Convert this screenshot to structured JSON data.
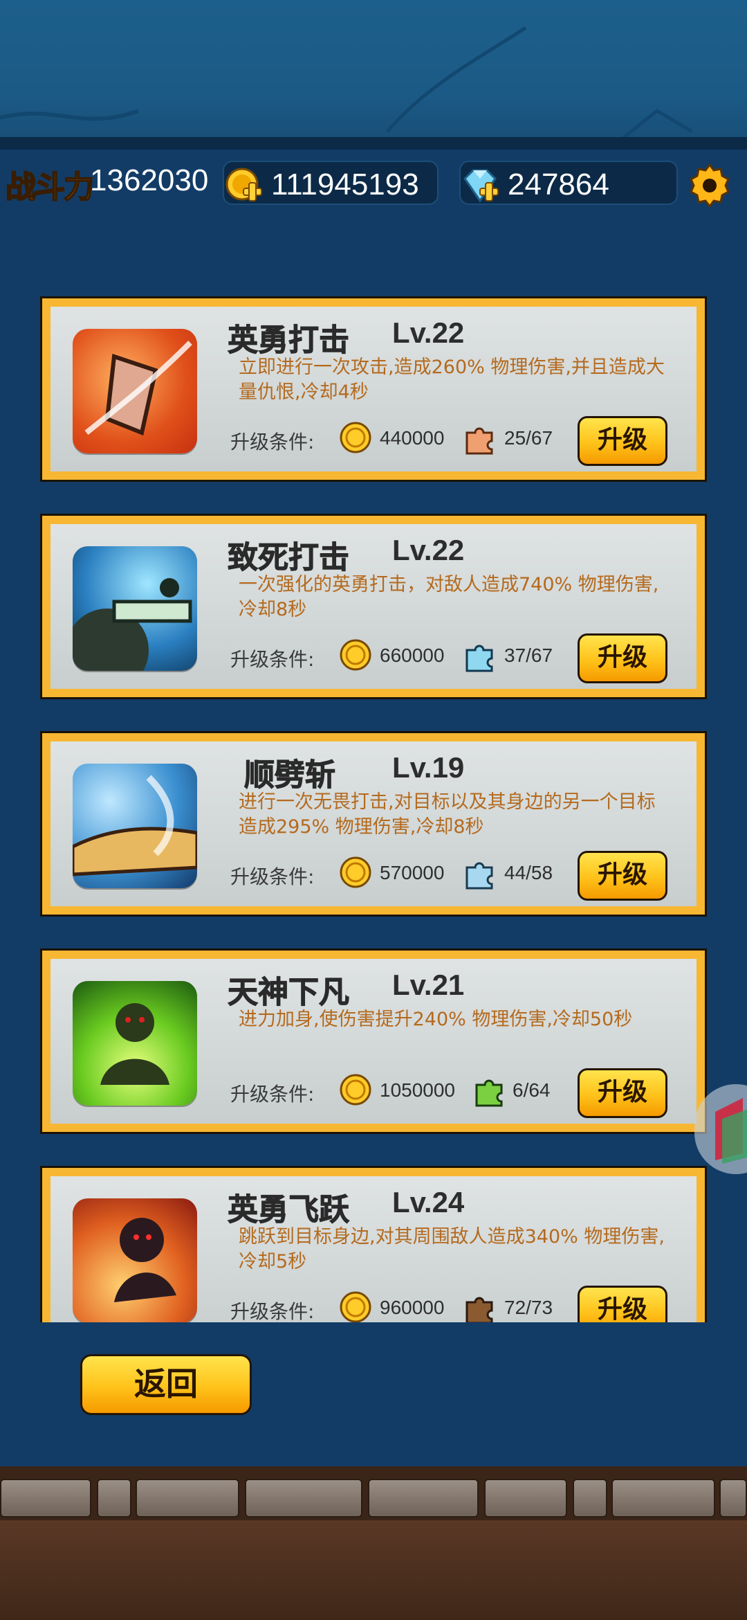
{
  "header": {
    "power_label": "战斗力",
    "power_value": "1362030",
    "gold_value": "111945193",
    "gem_value": "247864",
    "icons": {
      "gold": "gold-coin-plus-icon",
      "gem": "gem-plus-icon",
      "settings": "gear-icon"
    }
  },
  "skills": [
    {
      "name": "英勇打击",
      "level": "Lv.22",
      "desc": "立即进行一次攻击,造成260% 物理伤害,并且造成大量仇恨,冷却4秒",
      "upgrade_label": "升级条件:",
      "coin_cost": "440000",
      "fragments": "25/67",
      "button": "升级",
      "icon": "shield-slash-skill-icon"
    },
    {
      "name": "致死打击",
      "level": "Lv.22",
      "desc": "一次强化的英勇打击，对敌人造成740% 物理伤害,冷却8秒",
      "upgrade_label": "升级条件:",
      "coin_cost": "660000",
      "fragments": "37/67",
      "button": "升级",
      "icon": "skull-sword-skill-icon"
    },
    {
      "name": "顺劈斩",
      "level": "Lv.19",
      "desc": "进行一次无畏打击,对目标以及其身边的另一个目标造成295% 物理伤害,冷却8秒",
      "upgrade_label": "升级条件:",
      "coin_cost": "570000",
      "fragments": "44/58",
      "button": "升级",
      "icon": "cleave-skill-icon"
    },
    {
      "name": "天神下凡",
      "level": "Lv.21",
      "desc": "进力加身,使伤害提升240% 物理伤害,冷却50秒",
      "upgrade_label": "升级条件:",
      "coin_cost": "1050000",
      "fragments": "6/64",
      "button": "升级",
      "icon": "avatar-skill-icon"
    },
    {
      "name": "英勇飞跃",
      "level": "Lv.24",
      "desc": "跳跃到目标身边,对其周围敌人造成340% 物理伤害,冷却5秒",
      "upgrade_label": "升级条件:",
      "coin_cost": "960000",
      "fragments": "72/73",
      "button": "升级",
      "icon": "heroic-leap-skill-icon"
    }
  ],
  "back_button": "返回",
  "colors": {
    "card_border": "#f7b733",
    "button": "#ffc21a",
    "desc_text": "#b46a1e",
    "bg": "#123c66"
  }
}
